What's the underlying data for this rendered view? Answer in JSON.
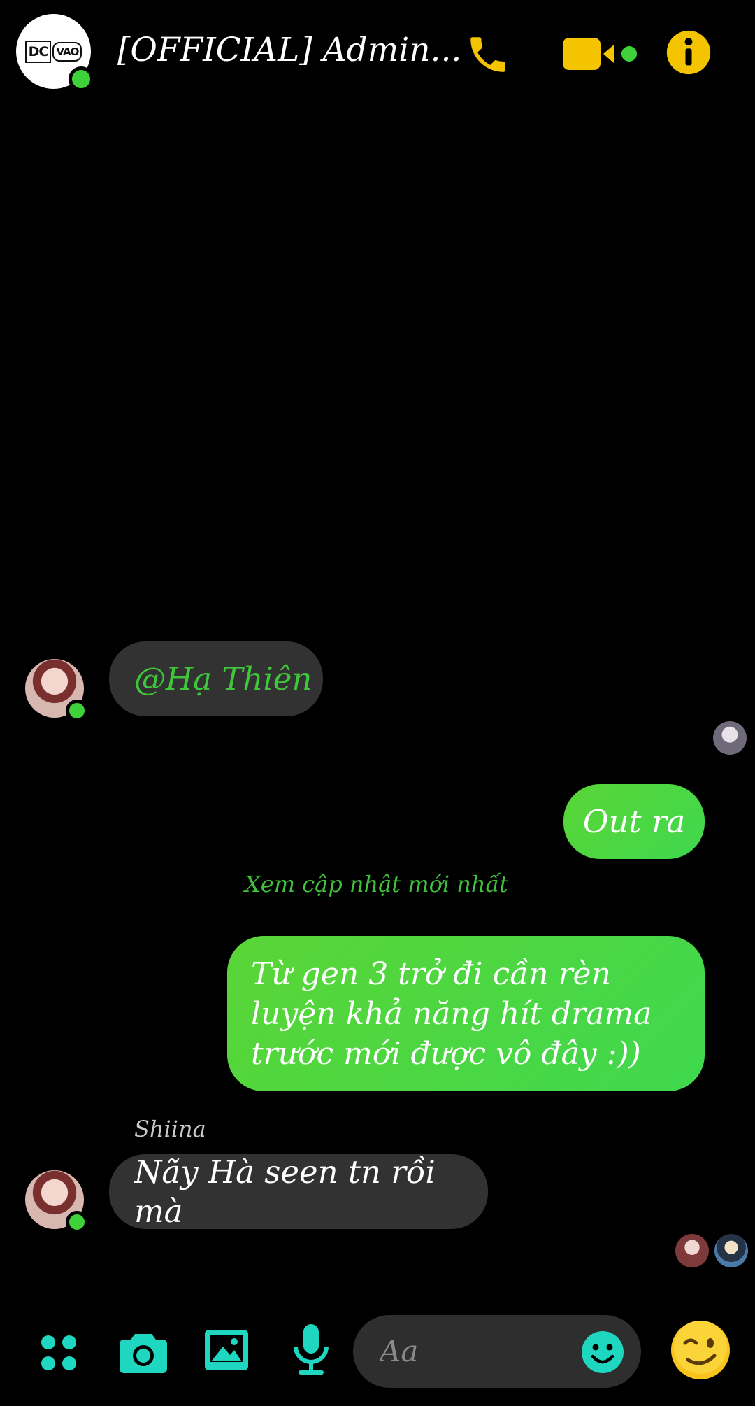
{
  "header": {
    "group_logo_left": "DC",
    "group_logo_right": "VAO",
    "title": "[OFFICIAL] Admin...",
    "icons": [
      "phone-icon",
      "video-icon",
      "info-icon"
    ],
    "accent_color": "#f5c400"
  },
  "messages": [
    {
      "direction": "incoming",
      "text": "@Hạ Thiên"
    },
    {
      "direction": "outgoing",
      "text": "Out ra"
    },
    {
      "direction": "outgoing",
      "text": "Từ gen 3 trở đi cần rèn luyện khả năng hít drama trước mới được vô đây :))"
    },
    {
      "direction": "incoming",
      "sender": "Shiina",
      "text": "Nãy Hà seen tn rồi mà"
    }
  ],
  "update_link": "Xem cập nhật mới nhất",
  "composer": {
    "placeholder": "Aa",
    "icons": [
      "apps-icon",
      "camera-icon",
      "image-icon",
      "microphone-icon",
      "emoji-icon",
      "wink-emoji-icon"
    ],
    "accent_color": "#1fd6c0"
  },
  "colors": {
    "background": "#000000",
    "incoming_bubble": "#323232",
    "outgoing_bubble": "#4cd64a",
    "online": "#3fd13a"
  }
}
